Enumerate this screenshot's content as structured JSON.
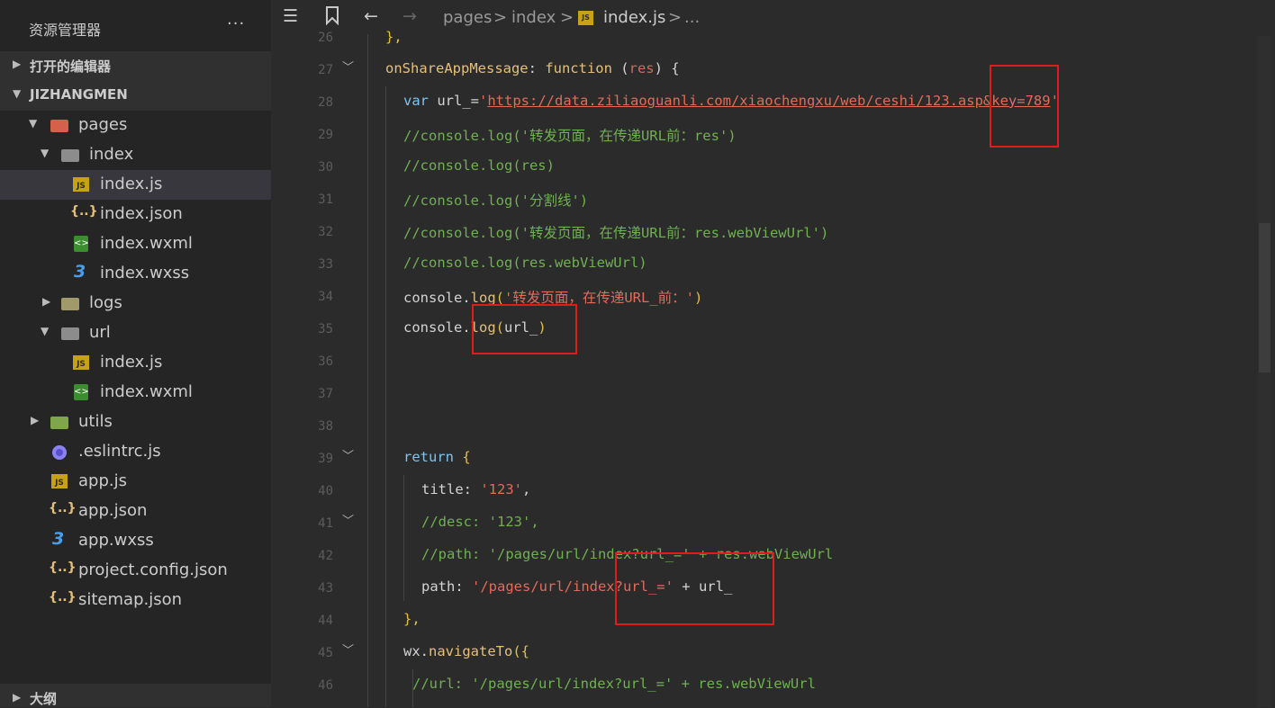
{
  "sidebar": {
    "title": "资源管理器",
    "more": "···",
    "open_editors": "打开的编辑器",
    "project": "JIZHANGMEN",
    "outline": "大纲",
    "tree": [
      {
        "label": "pages",
        "icon": "folder-pages-icon"
      },
      {
        "label": "index",
        "icon": "folder-icon"
      },
      {
        "label": "index.js",
        "icon": "js-file-icon"
      },
      {
        "label": "index.json",
        "icon": "json-file-icon"
      },
      {
        "label": "index.wxml",
        "icon": "wxml-file-icon"
      },
      {
        "label": "index.wxss",
        "icon": "wxss-file-icon"
      },
      {
        "label": "logs",
        "icon": "folder-logs-icon"
      },
      {
        "label": "url",
        "icon": "folder-icon"
      },
      {
        "label": "index.js",
        "icon": "js-file-icon"
      },
      {
        "label": "index.wxml",
        "icon": "wxml-file-icon"
      },
      {
        "label": "utils",
        "icon": "folder-utils-icon"
      },
      {
        "label": ".eslintrc.js",
        "icon": "eslint-file-icon"
      },
      {
        "label": "app.js",
        "icon": "js-file-icon"
      },
      {
        "label": "app.json",
        "icon": "json-file-icon"
      },
      {
        "label": "app.wxss",
        "icon": "wxss-file-icon"
      },
      {
        "label": "project.config.json",
        "icon": "json-file-icon"
      },
      {
        "label": "sitemap.json",
        "icon": "json-file-icon"
      }
    ]
  },
  "breadcrumb": {
    "pages": "pages",
    "index": "index",
    "file": "index.js",
    "ellipsis": "...",
    "sep": ">"
  },
  "icons": {
    "list": "list-icon",
    "bookmark": "bookmark-icon",
    "back": "arrow-left-icon",
    "forward": "arrow-right-icon",
    "js_badge": "JS",
    "json_badge": "{..}",
    "css_badge": "3",
    "wxml_badge": "<>"
  },
  "line_numbers": [
    "26",
    "27",
    "28",
    "29",
    "30",
    "31",
    "32",
    "33",
    "34",
    "35",
    "36",
    "37",
    "38",
    "39",
    "40",
    "41",
    "42",
    "43",
    "44",
    "45",
    "46"
  ],
  "code": {
    "l26": "},",
    "l27_name": "onShareAppMessage",
    "l27_colon": ": ",
    "l27_fn": "function",
    "l27_open": " (",
    "l27_param": "res",
    "l27_close": ") {",
    "l28_var": "var",
    "l28_mid": " url_=",
    "l28_q1": "'",
    "l28_url": "https://data.ziliaoguanli.com/xiaochengxu/web/ceshi/123.asp&key=789",
    "l28_q2": "'",
    "l29": "//console.log('转发页面，在传递URL前：res')",
    "l30": "//console.log(res)",
    "l31": "//console.log('分割线')",
    "l32": "//console.log('转发页面，在传递URL前：res.webViewUrl')",
    "l33": "//console.log(res.webViewUrl)",
    "l34_obj": "console.",
    "l34_fn": "log",
    "l34_open": "(",
    "l34_str": "'转发页面，在传递URL_前：'",
    "l34_close": ")",
    "l35_obj": "console.",
    "l35_fn": "log",
    "l35_open": "(",
    "l35_arg": "url_",
    "l35_close": ")",
    "l39_ret": "return",
    "l39_brace": " {",
    "l40_key": "title: ",
    "l40_val": "'123'",
    "l40_comma": ",",
    "l41": "//desc: '123',",
    "l42": "//path: '/pages/url/index?url_=' + res.webViewUrl",
    "l43_key": "path: ",
    "l43_val": "'/pages/url/index?url_='",
    "l43_rest": " + url_",
    "l44": "},",
    "l45_obj": "wx.",
    "l45_fn": "navigateTo",
    "l45_open": "({",
    "l46": "//url: '/pages/url/index?url_=' + res.webViewUrl"
  },
  "colors": {
    "highlight_box": "#e01b1b",
    "keyword": "#7ec4ee",
    "function_name": "#e5c07b",
    "string": "#e06c5c",
    "comment": "#6fb150"
  }
}
